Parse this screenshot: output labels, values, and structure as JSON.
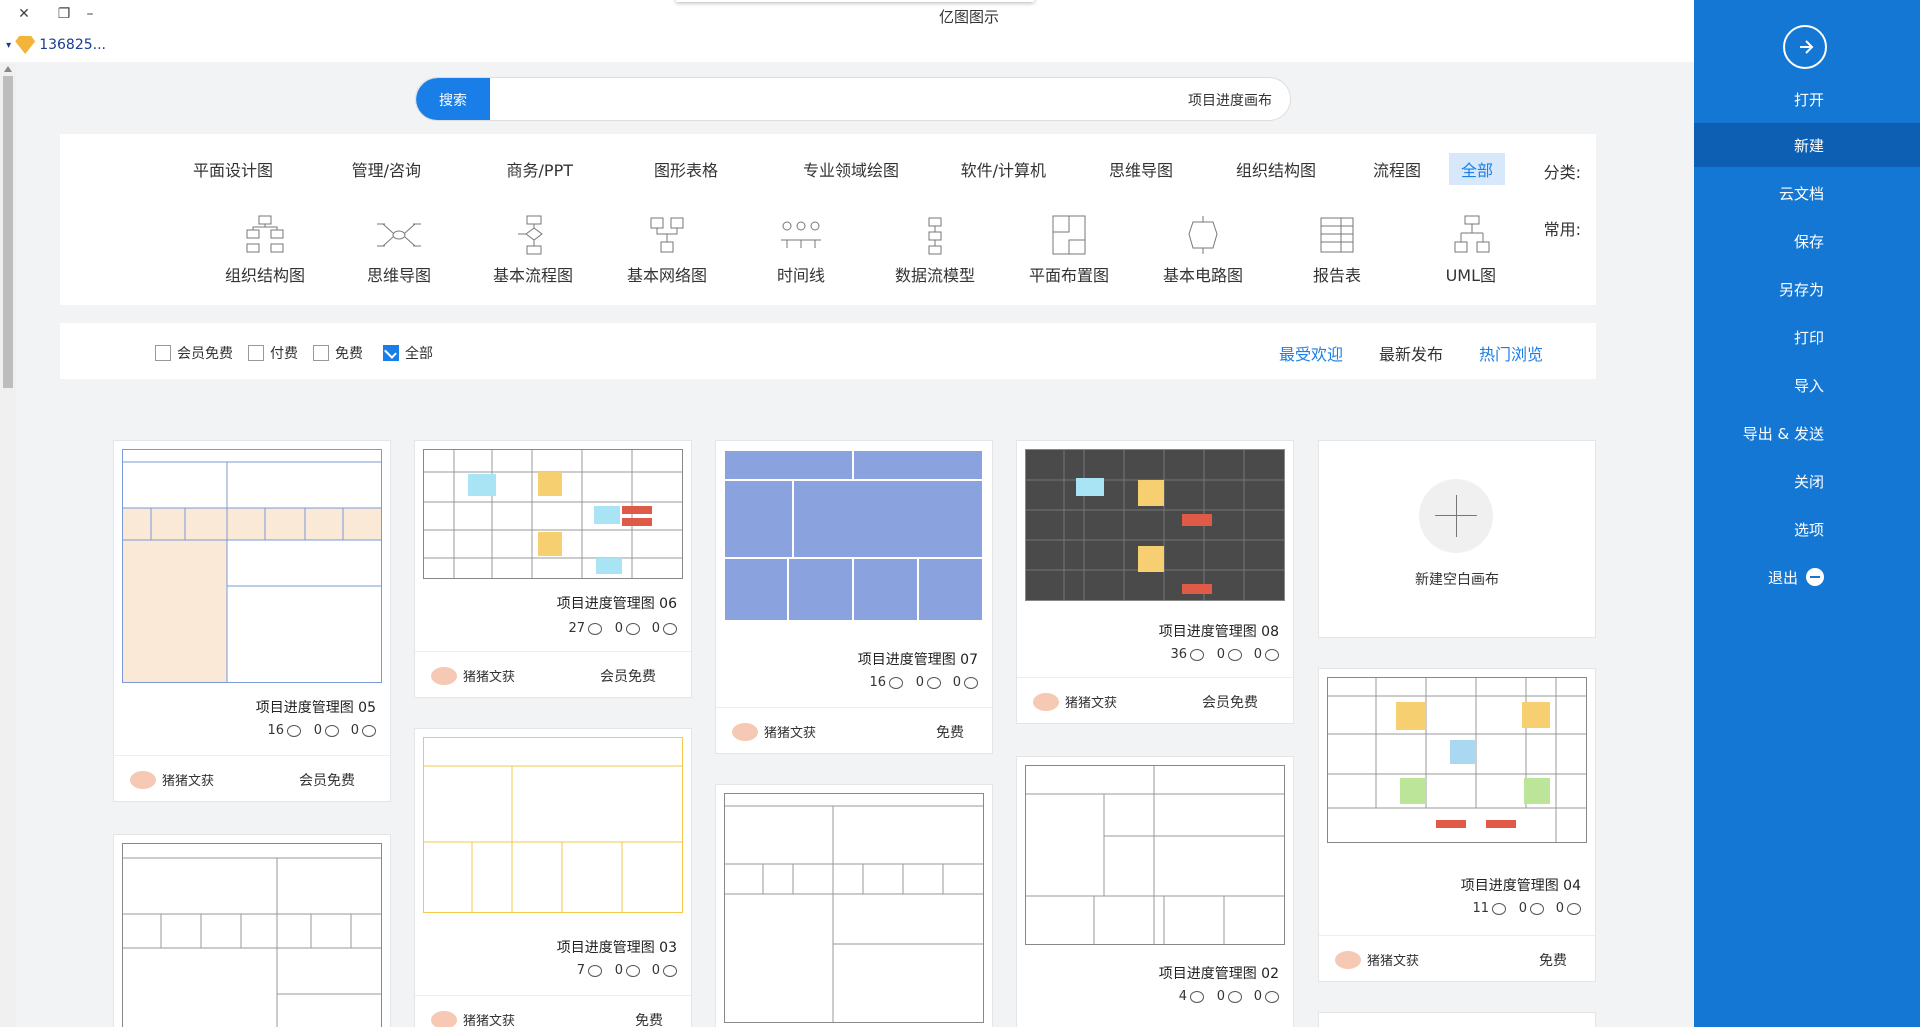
{
  "window": {
    "title": "亿图图示",
    "close": "✕",
    "restore": "❐",
    "minimize": "–"
  },
  "user": {
    "name": "136825..."
  },
  "sidebar": {
    "items": [
      {
        "id": "open",
        "label": "打开"
      },
      {
        "id": "new",
        "label": "新建",
        "active": true
      },
      {
        "id": "cloud",
        "label": "云文档"
      },
      {
        "id": "save",
        "label": "保存"
      },
      {
        "id": "saveas",
        "label": "另存为"
      },
      {
        "id": "print",
        "label": "打印"
      },
      {
        "id": "import",
        "label": "导入"
      },
      {
        "id": "export",
        "label": "导出 & 发送"
      },
      {
        "id": "close",
        "label": "关闭"
      },
      {
        "id": "options",
        "label": "选项"
      },
      {
        "id": "exit",
        "label": "退出"
      }
    ]
  },
  "search": {
    "query": "项目进度画布",
    "button": "搜索"
  },
  "categories": {
    "label": "分类:",
    "items": [
      "全部",
      "流程图",
      "组织结构图",
      "思维导图",
      "软件/计算机",
      "专业领域绘图",
      "图形表格",
      "商务/PPT",
      "管理/咨询",
      "平面设计图"
    ],
    "active": "全部"
  },
  "common": {
    "label": "常用:",
    "items": [
      "UML图",
      "报告表",
      "基本电路图",
      "平面布置图",
      "数据流模型",
      "时间线",
      "基本网络图",
      "基本流程图",
      "思维导图",
      "组织结构图"
    ]
  },
  "filter": {
    "sorts": [
      "热门浏览",
      "最新发布",
      "最受欢迎"
    ],
    "checks": [
      {
        "label": "全部",
        "checked": true
      },
      {
        "label": "免费",
        "checked": false
      },
      {
        "label": "付费",
        "checked": false
      },
      {
        "label": "会员免费",
        "checked": false
      }
    ]
  },
  "newcanvas": {
    "label": "新建空白画布"
  },
  "templates": [
    {
      "id": "08",
      "name": "项目进度管理图 08",
      "views": "36",
      "likes": "0",
      "favs": "0",
      "author": "猪猪文获",
      "price": "会员免费"
    },
    {
      "id": "07",
      "name": "项目进度管理图 07",
      "views": "16",
      "likes": "0",
      "favs": "0",
      "author": "猪猪文获",
      "price": "免费"
    },
    {
      "id": "06",
      "name": "项目进度管理图 06",
      "views": "27",
      "likes": "0",
      "favs": "0",
      "author": "猪猪文获",
      "price": "会员免费"
    },
    {
      "id": "05",
      "name": "项目进度管理图 05",
      "views": "16",
      "likes": "0",
      "favs": "0",
      "author": "猪猪文获",
      "price": "会员免费"
    },
    {
      "id": "04",
      "name": "项目进度管理图 04",
      "views": "11",
      "likes": "0",
      "favs": "0",
      "author": "猪猪文获",
      "price": "免费"
    },
    {
      "id": "02",
      "name": "项目进度管理图 02",
      "views": "4",
      "likes": "0",
      "favs": "0"
    },
    {
      "id": "03",
      "name": "项目进度管理图 03",
      "views": "7",
      "likes": "0",
      "favs": "0",
      "author": "猪猪文获",
      "price": "免费"
    }
  ]
}
